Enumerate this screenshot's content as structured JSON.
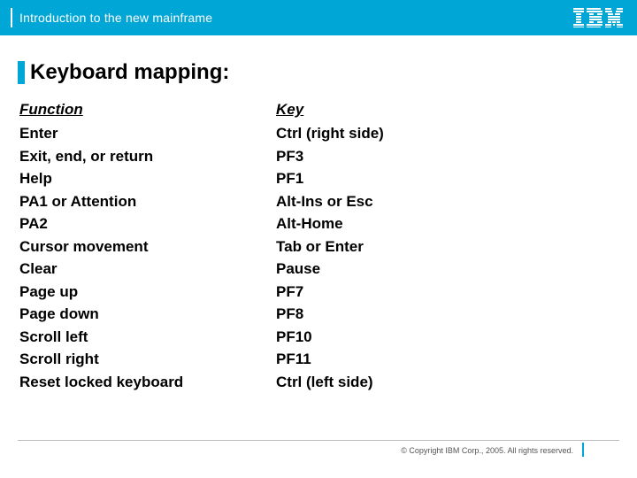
{
  "header": {
    "title": "Introduction to the new mainframe",
    "logo_name": "ibm-logo"
  },
  "slide": {
    "title": "Keyboard mapping:"
  },
  "table": {
    "function_header": "Function",
    "key_header": "Key",
    "rows": [
      {
        "function": "Enter",
        "key": "Ctrl (right side)"
      },
      {
        "function": "Exit, end, or return",
        "key": "PF3"
      },
      {
        "function": "Help",
        "key": "PF1"
      },
      {
        "function": "PA1 or Attention",
        "key": "Alt-Ins or Esc"
      },
      {
        "function": "PA2",
        "key": "Alt-Home"
      },
      {
        "function": "Cursor movement",
        "key": "Tab or Enter"
      },
      {
        "function": "Clear",
        "key": "Pause"
      },
      {
        "function": "Page up",
        "key": "PF7"
      },
      {
        "function": "Page down",
        "key": "PF8"
      },
      {
        "function": "Scroll left",
        "key": "PF10"
      },
      {
        "function": "Scroll right",
        "key": "PF11"
      },
      {
        "function": "Reset locked keyboard",
        "key": "Ctrl (left side)"
      }
    ]
  },
  "footer": {
    "copyright": "© Copyright IBM Corp., 2005. All rights reserved."
  }
}
